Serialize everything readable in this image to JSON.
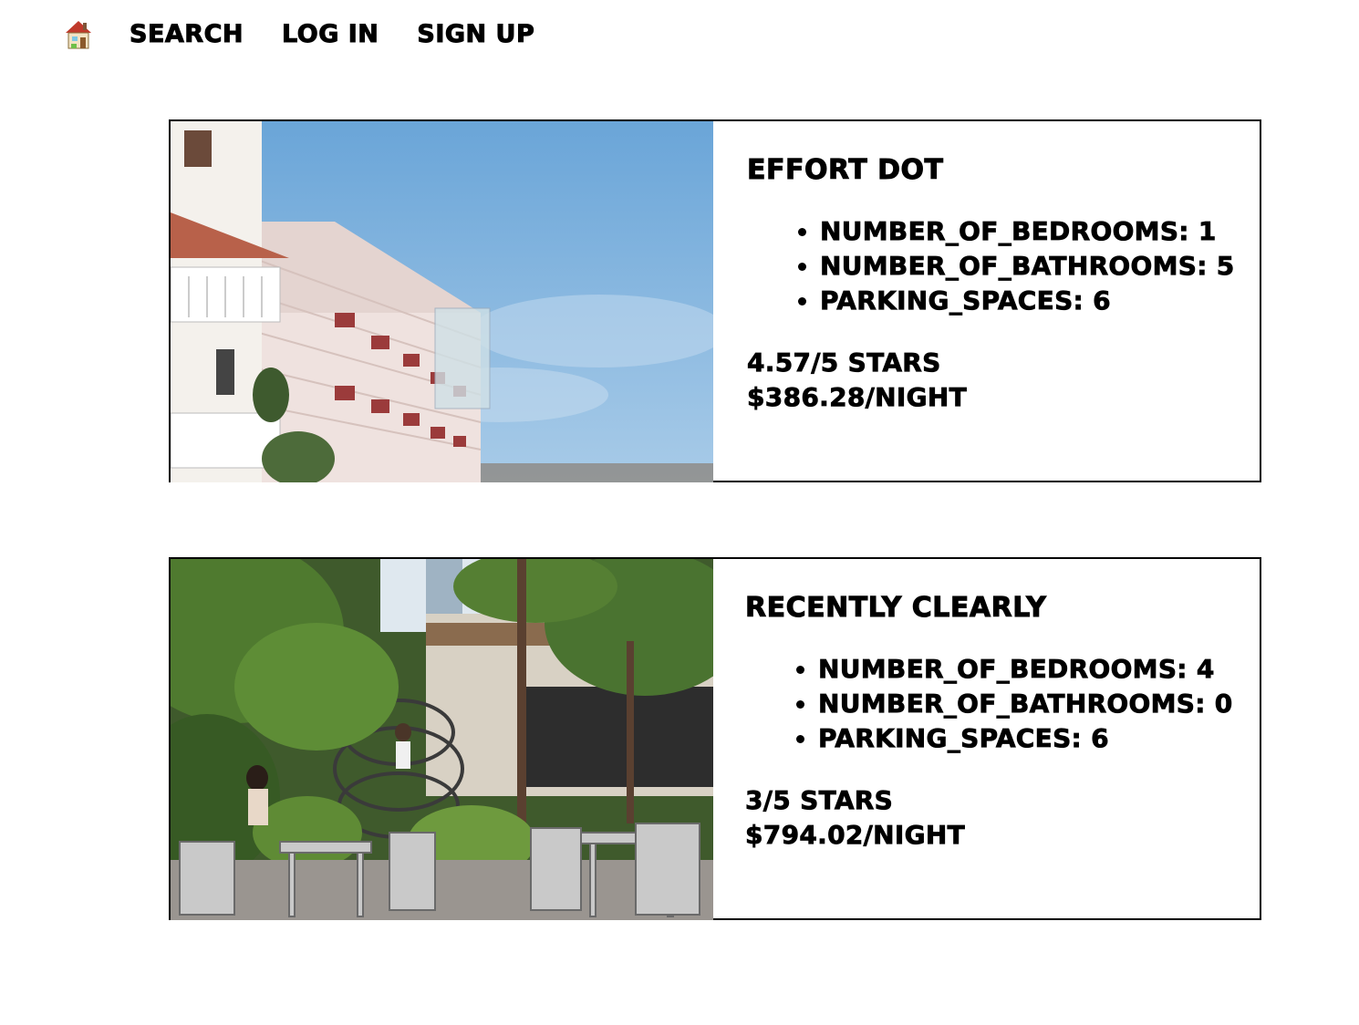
{
  "nav": {
    "home_icon": "house-icon",
    "links": [
      {
        "label": "Search"
      },
      {
        "label": "Log In"
      },
      {
        "label": "Sign Up"
      }
    ]
  },
  "listings": [
    {
      "title": "Effort Dot",
      "image": "building-balconies-sky-photo",
      "features": [
        "number_of_bedrooms: 1",
        "number_of_bathrooms: 5",
        "parking_spaces: 6"
      ],
      "rating": "4.57/5 stars",
      "price": "$386.28/night"
    },
    {
      "title": "Recently Clearly",
      "image": "garden-cafe-spiral-stairs-photo",
      "features": [
        "number_of_bedrooms: 4",
        "number_of_bathrooms: 0",
        "parking_spaces: 6"
      ],
      "rating": "3/5 stars",
      "price": "$794.02/night"
    }
  ]
}
